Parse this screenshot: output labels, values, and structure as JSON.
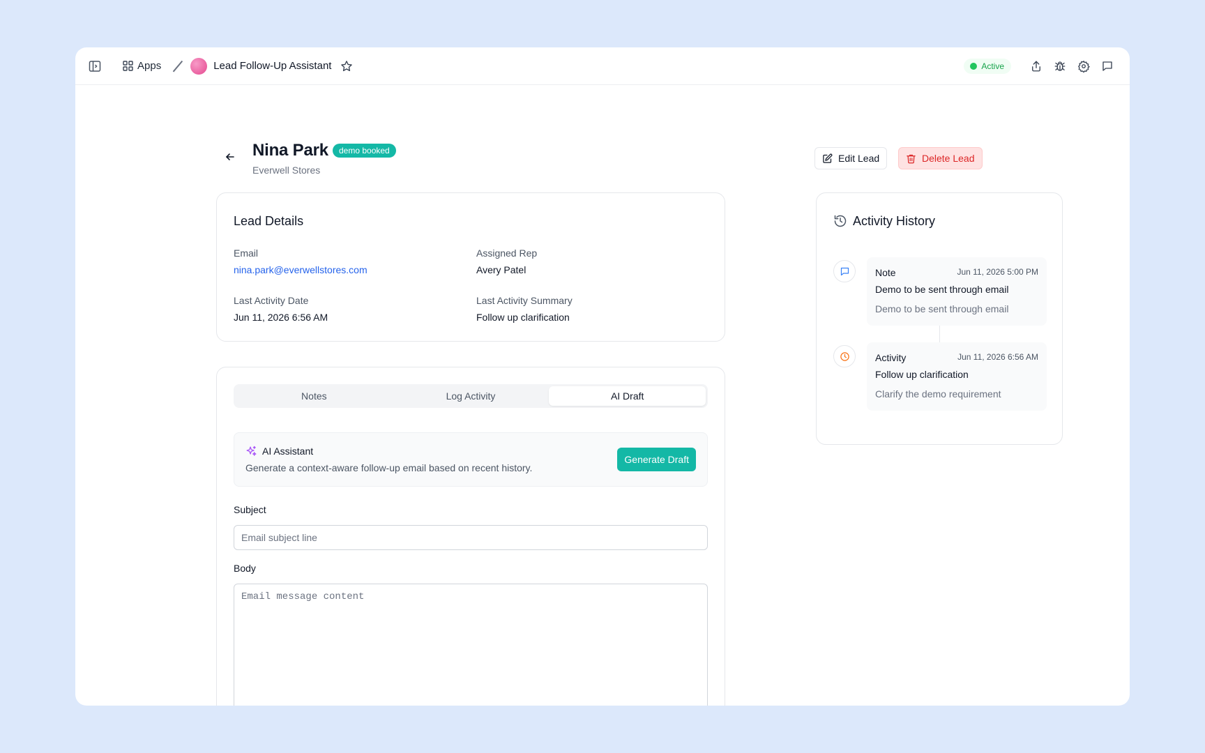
{
  "topbar": {
    "apps_label": "Apps",
    "app_title": "Lead Follow-Up Assistant",
    "status_label": "Active"
  },
  "lead": {
    "name": "Nina Park",
    "stage_badge": "demo booked",
    "company": "Everwell Stores",
    "edit_label": "Edit Lead",
    "delete_label": "Delete Lead"
  },
  "details": {
    "title": "Lead Details",
    "email_label": "Email",
    "email_value": "nina.park@everwellstores.com",
    "rep_label": "Assigned Rep",
    "rep_value": "Avery Patel",
    "last_date_label": "Last Activity Date",
    "last_date_value": "Jun 11, 2026 6:56 AM",
    "last_summary_label": "Last Activity Summary",
    "last_summary_value": "Follow up clarification"
  },
  "tabs": [
    {
      "label": "Notes"
    },
    {
      "label": "Log Activity"
    },
    {
      "label": "AI Draft"
    }
  ],
  "ai": {
    "title": "AI Assistant",
    "description": "Generate a context-aware follow-up email based on recent history.",
    "generate_label": "Generate Draft"
  },
  "form": {
    "subject_label": "Subject",
    "subject_placeholder": "Email subject line",
    "body_label": "Body",
    "body_placeholder": "Email message content"
  },
  "history": {
    "title": "Activity History",
    "entries": [
      {
        "type": "Note",
        "date": "Jun 11, 2026 5:00 PM",
        "headline": "Demo to be sent through email",
        "body": "Demo to be sent through email",
        "icon": "message-icon",
        "color": "#3b82f6"
      },
      {
        "type": "Activity",
        "date": "Jun 11, 2026 6:56 AM",
        "headline": "Follow up clarification",
        "body": "Clarify the demo requirement",
        "icon": "clock-icon",
        "color": "#f97316"
      }
    ]
  },
  "colors": {
    "accent": "#14b8a6",
    "danger": "#dc2626",
    "link": "#2563eb",
    "background": "#dce8fb"
  }
}
